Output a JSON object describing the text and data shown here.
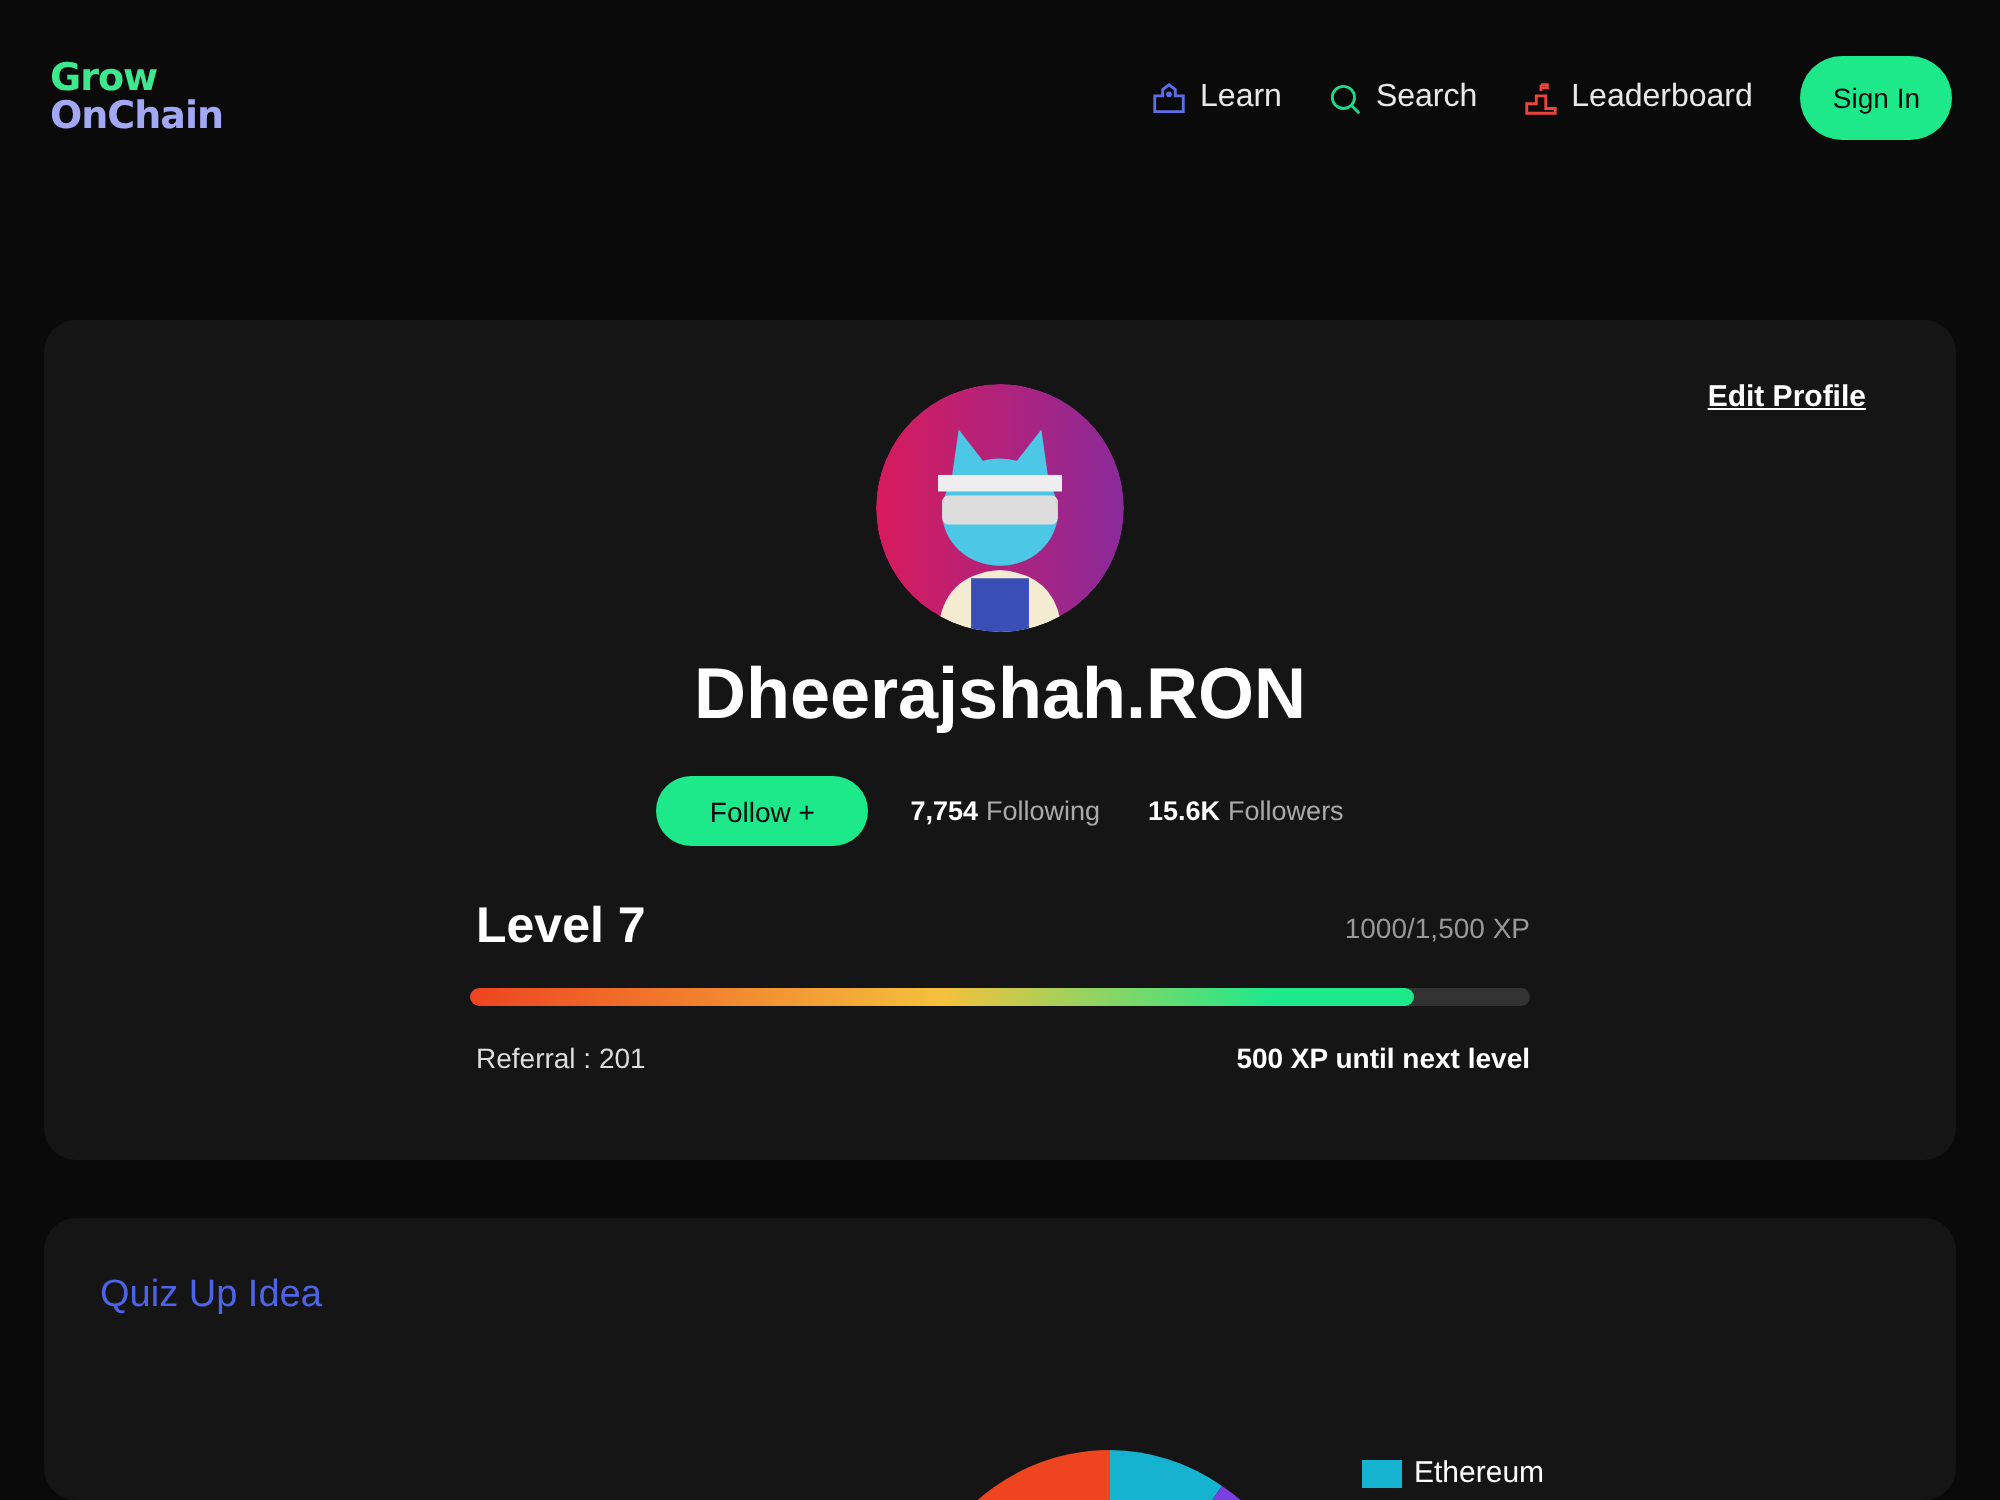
{
  "logo": {
    "line_1": "Grow",
    "line_2": "OnChain"
  },
  "nav": [
    {
      "label": "Learn"
    },
    {
      "label": "Search"
    },
    {
      "label": "Leaderboard"
    }
  ],
  "sign_in": "Sign In",
  "profile": {
    "edit": "Edit Profile",
    "username": "Dheerajshah.RON",
    "follow": "Follow +",
    "following_count": "7,754",
    "following_label": "Following",
    "followers_count": "15.6K",
    "followers_label": "Followers",
    "level_title": "Level 7",
    "xp": "1000/1,500 XP",
    "level": 0.89,
    "referral": "Referral : 201",
    "remaining": "500 XP until next level"
  },
  "quiz": {
    "title": "Quiz Up Idea",
    "legend": [
      {
        "label": "Ethereum",
        "color": "#16b3d0"
      }
    ]
  }
}
